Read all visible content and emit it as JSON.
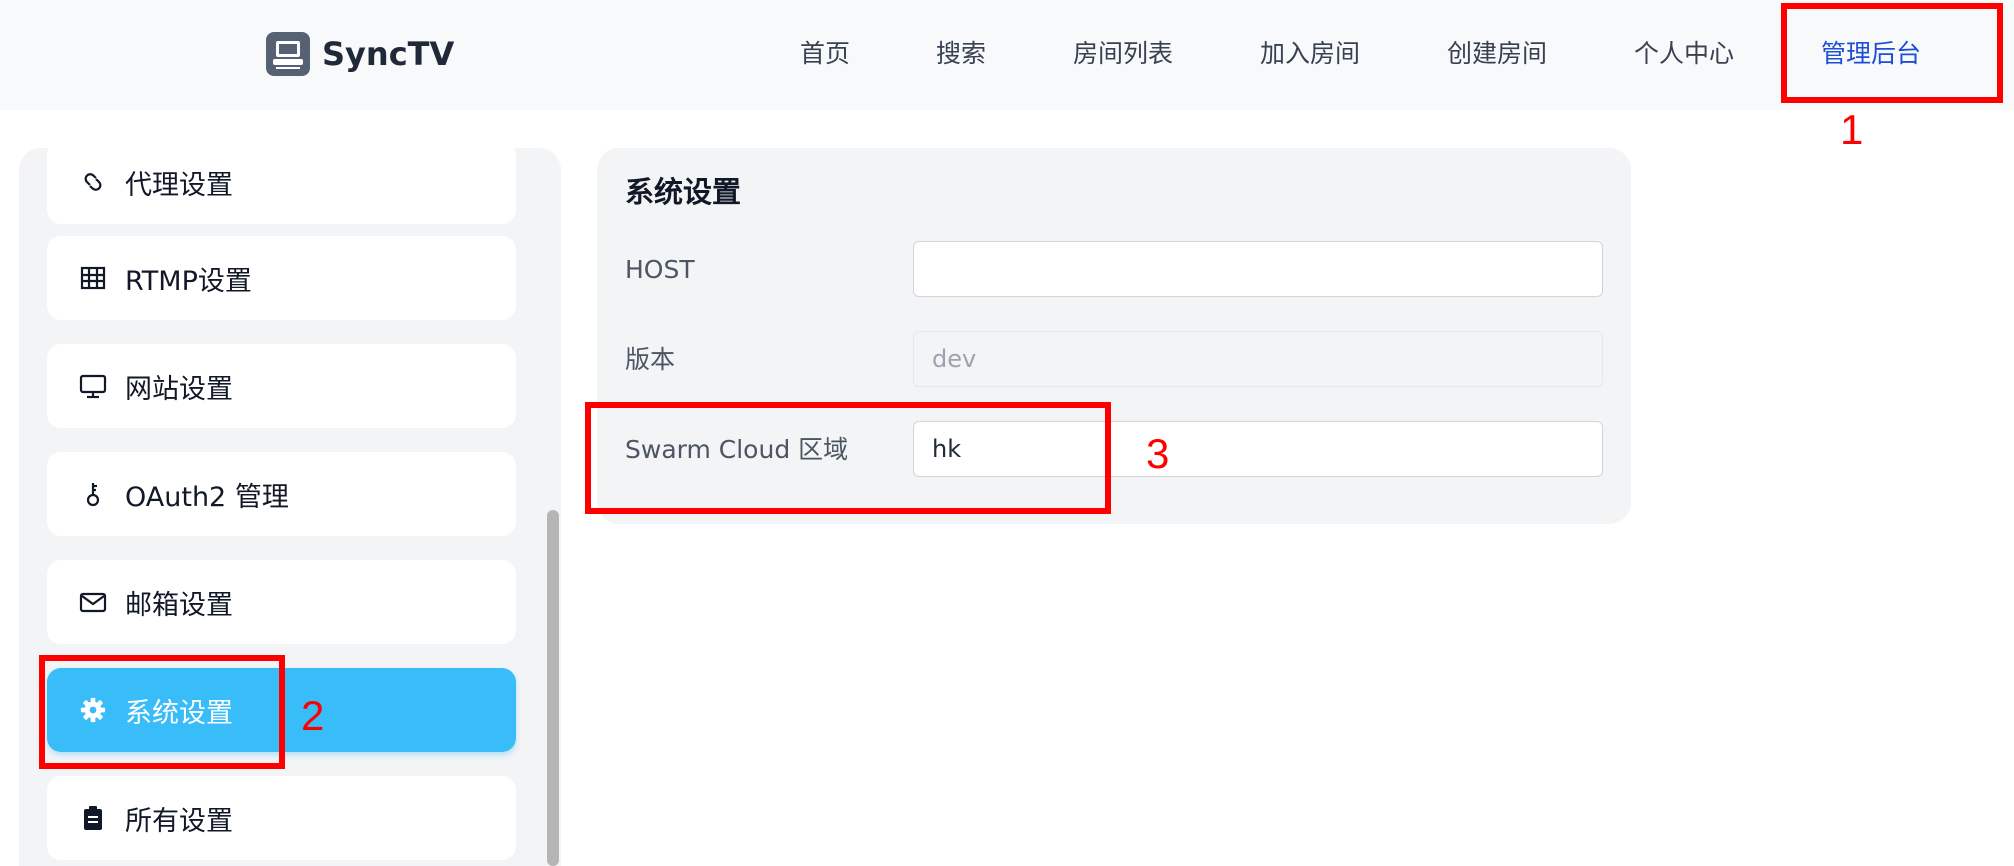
{
  "header": {
    "brand": "SyncTV",
    "nav": [
      "首页",
      "搜索",
      "房间列表",
      "加入房间",
      "创建房间",
      "个人中心",
      "管理后台"
    ],
    "active_nav": "管理后台"
  },
  "sidebar": {
    "items": [
      {
        "label": "代理设置",
        "icon": "link-icon"
      },
      {
        "label": "RTMP设置",
        "icon": "grid-icon"
      },
      {
        "label": "网站设置",
        "icon": "monitor-icon"
      },
      {
        "label": "OAuth2 管理",
        "icon": "key-icon"
      },
      {
        "label": "邮箱设置",
        "icon": "mail-icon"
      },
      {
        "label": "系统设置",
        "icon": "gear-icon",
        "active": true
      },
      {
        "label": "所有设置",
        "icon": "clipboard-icon"
      }
    ]
  },
  "panel": {
    "title": "系统设置",
    "rows": [
      {
        "label": "HOST",
        "value": ""
      },
      {
        "label": "版本",
        "value": "dev",
        "disabled": true
      },
      {
        "label": "Swarm Cloud 区域",
        "value": "hk"
      }
    ]
  },
  "annotations": [
    "1",
    "2",
    "3"
  ],
  "colors": {
    "accent": "#38bdf8",
    "nav_active": "#1d4ed8",
    "annotation": "#ff0000"
  }
}
